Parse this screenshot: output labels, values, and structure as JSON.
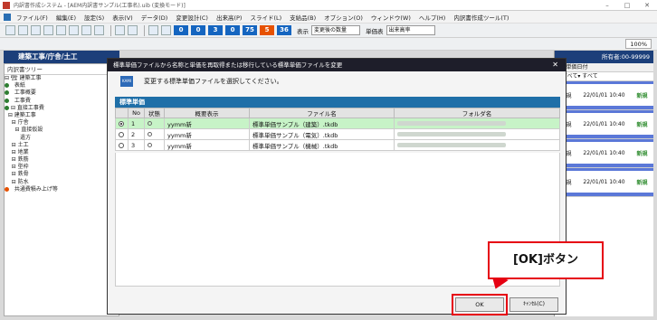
{
  "window": {
    "title": "内訳書作成システム - [AEM内訳書サンプル(工事名).uib (変換モード)]",
    "controls": [
      "–",
      "□",
      "✕"
    ]
  },
  "menu": {
    "items": [
      "ファイル(F)",
      "編集(E)",
      "設定(S)",
      "表示(V)",
      "データ(D)",
      "変更設計(C)",
      "出来高(P)",
      "スライド(L)",
      "支給品(B)",
      "オプション(O)",
      "ウィンドウ(W)",
      "ヘルプ(H)",
      "内訳書作成ツール(T)"
    ]
  },
  "toolbar": {
    "counters": [
      {
        "value": "0",
        "color": "#1565c0"
      },
      {
        "value": "0",
        "color": "#1565c0"
      },
      {
        "value": "3",
        "color": "#1565c0"
      },
      {
        "value": "0",
        "color": "#1565c0"
      },
      {
        "value": "75",
        "color": "#1565c0"
      },
      {
        "value": "5",
        "color": "#e65100"
      },
      {
        "value": "36",
        "color": "#1565c0"
      }
    ],
    "select_label": "表示",
    "select_value": "変更後の数量",
    "select2_label": "単価表",
    "select2_value": "出来高率",
    "zoom": "100%"
  },
  "left": {
    "header": "建築工事/庁舎/土工",
    "tree_title": "内訳書ツリー",
    "tree": [
      {
        "label": "⊟ 🏗 建築工事",
        "dot": ""
      },
      {
        "label": "  表紙",
        "dot": "#2e7d32"
      },
      {
        "label": "  工事概要",
        "dot": "#2e7d32"
      },
      {
        "label": "  工事費",
        "dot": "#2e7d32"
      },
      {
        "label": "⊟ 直接工事費",
        "dot": "#2e7d32"
      },
      {
        "label": "  ⊟ 建築工事",
        "dot": ""
      },
      {
        "label": "    ⊟ 庁舎",
        "dot": ""
      },
      {
        "label": "      ⊟ 直接仮設",
        "dot": ""
      },
      {
        "label": "         遣方",
        "dot": ""
      },
      {
        "label": "    ⊟ 土工",
        "dot": ""
      },
      {
        "label": "    ⊟ 地業",
        "dot": ""
      },
      {
        "label": "    ⊟ 鉄筋",
        "dot": ""
      },
      {
        "label": "    ⊟ 型枠",
        "dot": ""
      },
      {
        "label": "    ⊟ 鉄骨",
        "dot": ""
      },
      {
        "label": "    ⊟ 防水",
        "dot": ""
      },
      {
        "label": "  共通費積み上げ等",
        "dot": "#e65100"
      }
    ]
  },
  "right": {
    "badge": "所有者:00-99999",
    "cols": "▼ 単価日付",
    "filter": "すべて▾ すべて",
    "rows": [
      {
        "tag": "新規",
        "date": "22/01/01 10:40",
        "kind": "新規"
      },
      {
        "tag": "新規",
        "date": "22/01/01 10:40",
        "kind": "新規"
      },
      {
        "tag": "新規",
        "date": "22/01/01 10:40",
        "kind": "新規"
      },
      {
        "tag": "新規",
        "date": "22/01/01 10:40",
        "kind": "新規"
      }
    ]
  },
  "dialog": {
    "title": "標準単価ファイルから名称と単価を再取得または移行している標準単価ファイルを変更",
    "close": "✕",
    "info_icon": "KAMI",
    "info_text": "変更する標準単価ファイルを選択してください。",
    "section": "標準単価",
    "columns": [
      "",
      "No",
      "状態",
      "概要表示",
      "ファイル名",
      "フォルダ名"
    ],
    "rows": [
      {
        "no": "1",
        "summary": "yymm新",
        "file": "標準単価サンプル（建築）.tkdb",
        "selected": true
      },
      {
        "no": "2",
        "summary": "yymm新",
        "file": "標準単価サンプル（電気）.tkdb",
        "selected": false
      },
      {
        "no": "3",
        "summary": "yymm新",
        "file": "標準単価サンプル（機械）.tkdb",
        "selected": false
      }
    ],
    "ok_label": "OK",
    "cancel_label": "ｷｬﾝｾﾙ(C)"
  },
  "callout": {
    "text": "[OK]ボタン",
    "color": "#e60012"
  }
}
